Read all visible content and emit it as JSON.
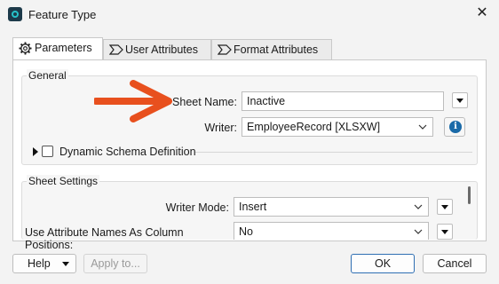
{
  "window": {
    "title": "Feature Type",
    "close_glyph": "✕",
    "app_icon": "fme-app-icon"
  },
  "tabs": [
    {
      "label": "Parameters",
      "icon": "gear-icon",
      "active": true
    },
    {
      "label": "User Attributes",
      "icon": "tag-icon",
      "active": false
    },
    {
      "label": "Format Attributes",
      "icon": "tag-icon",
      "active": false
    }
  ],
  "general": {
    "heading": "General",
    "sheet_name_label": "Sheet Name:",
    "sheet_name_value": "Inactive",
    "writer_label": "Writer:",
    "writer_value": "EmployeeRecord [XLSXW]",
    "info_glyph": "i",
    "dynamic_schema_label": "Dynamic Schema Definition",
    "dynamic_schema_checked": false
  },
  "annotation": {
    "arrow_color": "#e8501e",
    "points_to": "Sheet Name"
  },
  "sheet_settings": {
    "heading": "Sheet Settings",
    "writer_mode_label": "Writer Mode:",
    "writer_mode_value": "Insert",
    "attr_names_label": "Use Attribute Names As Column Positions:",
    "attr_names_value": "No"
  },
  "footer": {
    "help_label": "Help",
    "apply_label": "Apply to...",
    "ok_label": "OK",
    "cancel_label": "Cancel"
  },
  "colors": {
    "accent": "#2f6fb3",
    "info_icon": "#1a6aa8",
    "panel_bg": "#f6f6f6"
  }
}
